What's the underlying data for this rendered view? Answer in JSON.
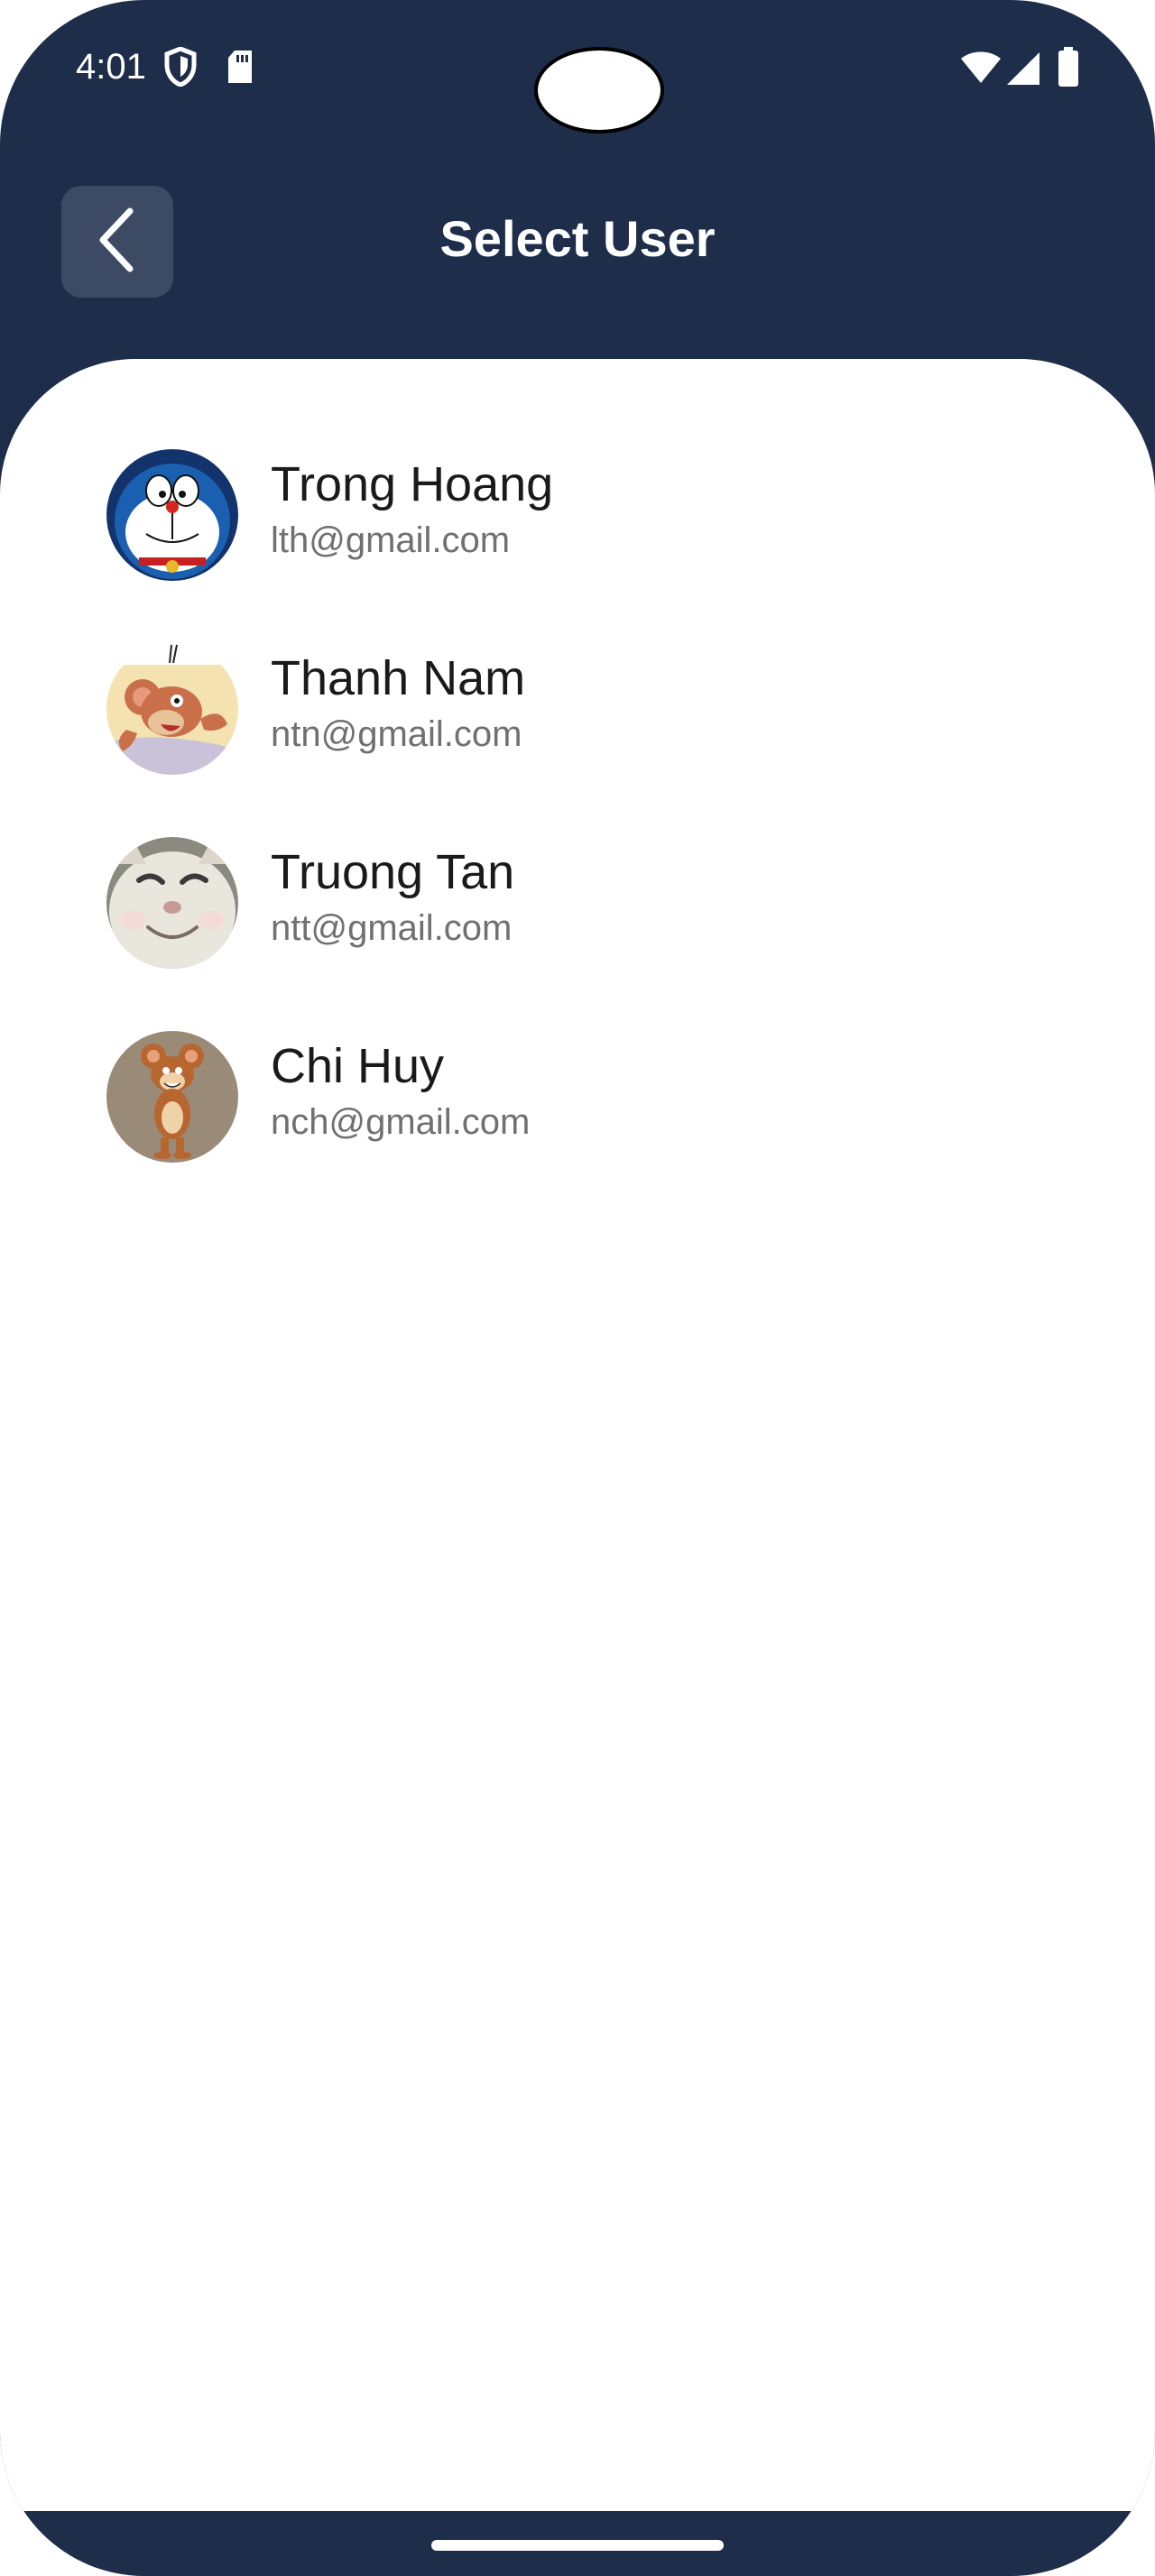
{
  "status_bar": {
    "time": "4:01",
    "left_icons": [
      "shield-icon",
      "sd-card-icon"
    ],
    "right_icons": [
      "wifi-icon",
      "signal-icon",
      "battery-icon"
    ]
  },
  "header": {
    "title": "Select User",
    "back_icon": "chevron-left-icon"
  },
  "colors": {
    "header_bg": "#1d2d4a",
    "card_bg": "#ffffff",
    "name_text": "#1a1a1a",
    "email_text": "#707070"
  },
  "users": [
    {
      "name": "Trong Hoang",
      "email": "lth@gmail.com",
      "avatar": "doraemon-avatar"
    },
    {
      "name": "Thanh Nam",
      "email": "ntn@gmail.com",
      "avatar": "jerry-mouse-avatar"
    },
    {
      "name": "Truong Tan",
      "email": "ntt@gmail.com",
      "avatar": "smiling-cat-avatar"
    },
    {
      "name": "Chi Huy",
      "email": "nch@gmail.com",
      "avatar": "jerry-standing-avatar"
    }
  ]
}
